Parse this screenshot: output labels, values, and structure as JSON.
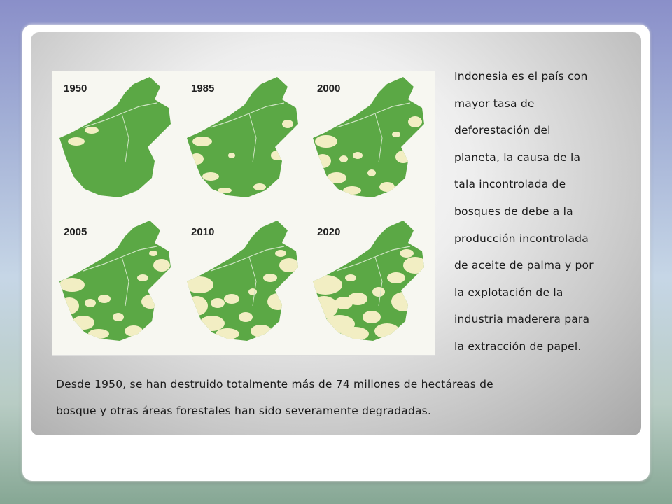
{
  "slide": {
    "maps": {
      "years": [
        "1950",
        "1985",
        "2000",
        "2005",
        "2010",
        "2020"
      ],
      "forest_color": "#5ba845",
      "cleared_color": "#f2eec3"
    },
    "side_lines": [
      "Indonesia es el país con",
      "mayor tasa de",
      "deforestación del",
      "planeta, la causa de la",
      "tala incontrolada de",
      "bosques de debe a la",
      "producción incontrolada",
      "de aceite de palma y por",
      "la explotación de la",
      "industria maderera para",
      "la extracción de papel."
    ],
    "bottom_lines": [
      "Desde 1950, se han destruido totalmente  más de 74 millones de hectáreas de",
      "bosque y otras áreas forestales han sido severamente  degradadas."
    ]
  }
}
